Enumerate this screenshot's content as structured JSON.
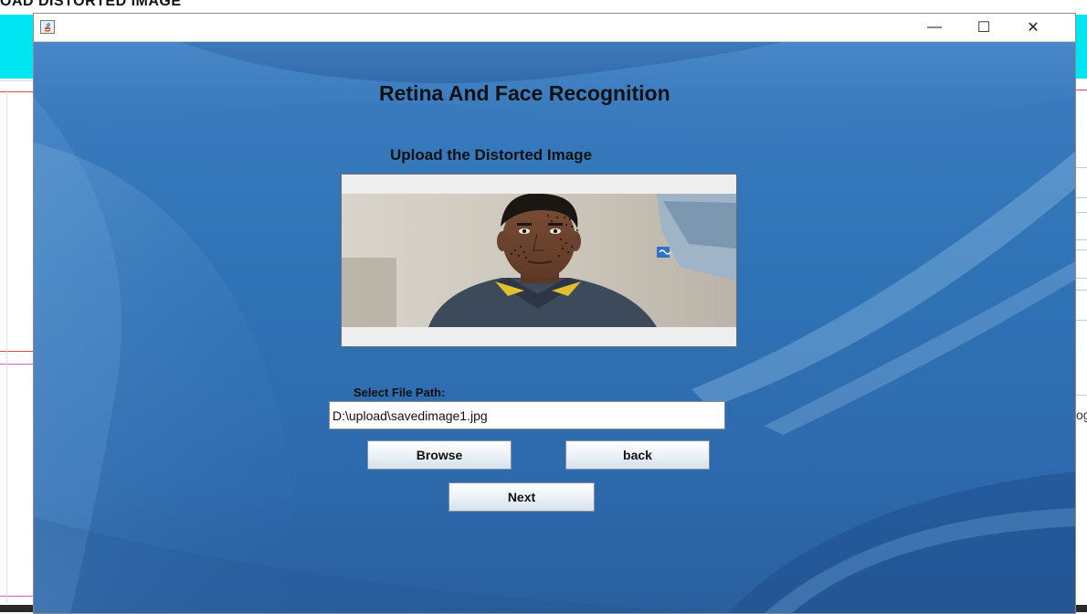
{
  "background": {
    "heading_fragment": "OAD DISTORTED IMAGE",
    "right_fragment": "og"
  },
  "window": {
    "icon": "java-app-icon",
    "controls": {
      "minimize": "—",
      "maximize": "☐",
      "close": "✕"
    }
  },
  "form": {
    "title": "Retina And Face Recognition",
    "subtitle": "Upload the Distorted Image",
    "file_path_label": "Select File Path:",
    "file_path_value": "D:\\upload\\savedimage1.jpg",
    "browse_label": "Browse",
    "back_label": "back",
    "next_label": "Next"
  },
  "colors": {
    "window_bg": "#2f72b7",
    "button_face": "#eef3f8",
    "accent_cyan": "#00e5f2"
  }
}
